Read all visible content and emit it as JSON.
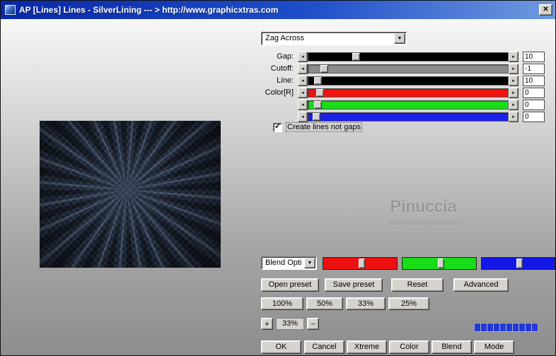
{
  "window": {
    "title": "AP [Lines]  Lines - SilverLining   --- > http://www.graphicxtras.com",
    "close_glyph": "✕"
  },
  "icons": {
    "dropdown_arrow": "▼",
    "left_arrow": "◄",
    "right_arrow": "►",
    "check": "✓"
  },
  "preset_dropdown": {
    "value": "Zag Across"
  },
  "sliders": {
    "rows": [
      {
        "label": "Gap:",
        "value": "10",
        "track_color": "#000000",
        "thumb_left": "22%"
      },
      {
        "label": "Cutoff:",
        "value": "-1",
        "track_color": "#8c8c8c",
        "thumb_left": "6%"
      },
      {
        "label": "Line:",
        "value": "10",
        "track_color": "#000000",
        "thumb_left": "3%"
      },
      {
        "label": "Color[R]",
        "value": "0",
        "track_color": "#ee1510",
        "thumb_left": "4%"
      },
      {
        "label": "",
        "value": "0",
        "track_color": "#1add1a",
        "thumb_left": "3%"
      },
      {
        "label": "",
        "value": "0",
        "track_color": "#1c22e8",
        "thumb_left": "2%"
      }
    ]
  },
  "checkbox": {
    "label": "Create lines not gaps",
    "checked": true
  },
  "watermark": {
    "name": "Pinuccia",
    "url": "www.maidiregrafica.eu"
  },
  "blend": {
    "dropdown_value": "Blend Opti",
    "channels": [
      {
        "color": "#ee1010",
        "thumb_left": "48%"
      },
      {
        "color": "#18dd18",
        "thumb_left": "48%"
      },
      {
        "color": "#1418e6",
        "thumb_left": "48%"
      }
    ]
  },
  "preset_buttons": {
    "open": "Open preset",
    "save": "Save preset",
    "reset": "Reset",
    "advanced": "Advanced"
  },
  "zoom": {
    "levels": [
      "100%",
      "50%",
      "33%",
      "25%"
    ],
    "plus": "+",
    "minus": "−",
    "current": "33%"
  },
  "progress": {
    "color": "#2438d6"
  },
  "actions": [
    "OK",
    "Cancel",
    "Xtreme",
    "Color",
    "Blend",
    "Mode"
  ]
}
